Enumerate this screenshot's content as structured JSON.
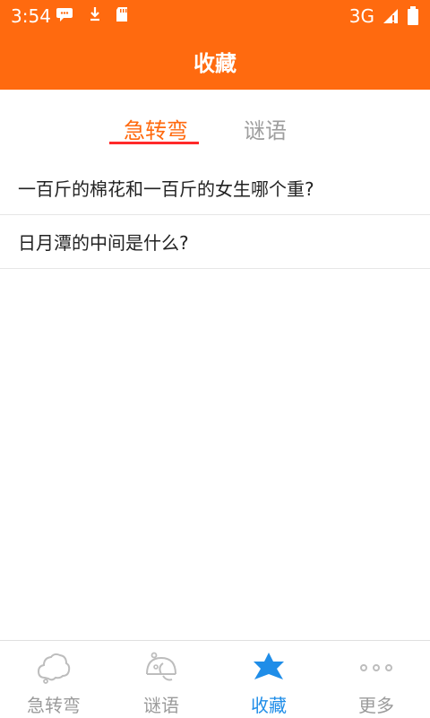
{
  "status_bar": {
    "time": "3:54",
    "network": "3G"
  },
  "header": {
    "title": "收藏"
  },
  "tabs": [
    {
      "label": "急转弯",
      "active": true
    },
    {
      "label": "谜语",
      "active": false
    }
  ],
  "favorites": [
    "一百斤的棉花和一百斤的女生哪个重?",
    "日月潭的中间是什么?"
  ],
  "bottom_nav": [
    {
      "label": "急转弯",
      "icon": "cloud-icon",
      "active": false
    },
    {
      "label": "谜语",
      "icon": "puzzle-icon",
      "active": false
    },
    {
      "label": "收藏",
      "icon": "star-icon",
      "active": true
    },
    {
      "label": "更多",
      "icon": "more-dots-icon",
      "active": false
    }
  ],
  "colors": {
    "brand": "#ff6a0f",
    "tab_underline": "#ff2a2a",
    "nav_active": "#1f8de8",
    "nav_inactive": "#9b9b9b"
  }
}
